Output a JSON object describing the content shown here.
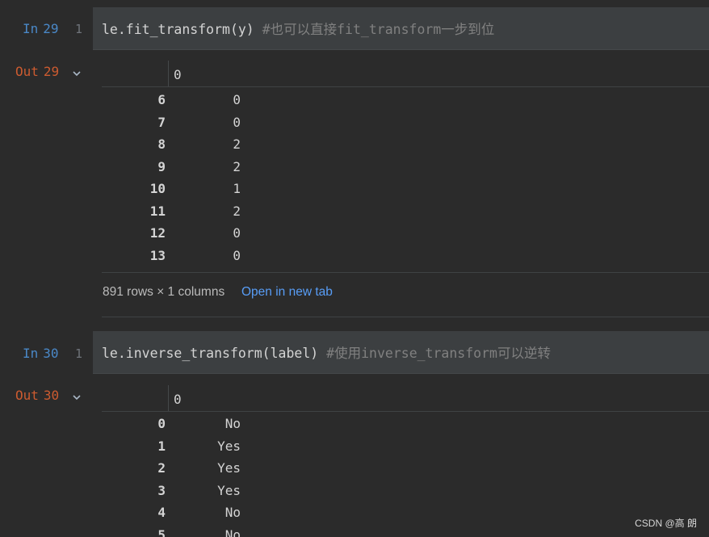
{
  "cells": [
    {
      "in_label": "In",
      "in_number": "29",
      "line_number": "1",
      "code": "le.fit_transform(y) ",
      "comment": "#也可以直接fit_transform一步到位",
      "out_label": "Out",
      "out_number": "29",
      "column_header": "0",
      "rows": [
        {
          "index": "6",
          "value": "0"
        },
        {
          "index": "7",
          "value": "0"
        },
        {
          "index": "8",
          "value": "2"
        },
        {
          "index": "9",
          "value": "2"
        },
        {
          "index": "10",
          "value": "1"
        },
        {
          "index": "11",
          "value": "2"
        },
        {
          "index": "12",
          "value": "0"
        },
        {
          "index": "13",
          "value": "0"
        }
      ],
      "footer_text": "891 rows × 1 columns",
      "footer_link": "Open in new tab"
    },
    {
      "in_label": "In",
      "in_number": "30",
      "line_number": "1",
      "code": "le.inverse_transform(label) ",
      "comment": "#使用inverse_transform可以逆转",
      "out_label": "Out",
      "out_number": "30",
      "column_header": "0",
      "rows": [
        {
          "index": "0",
          "value": "No"
        },
        {
          "index": "1",
          "value": "Yes"
        },
        {
          "index": "2",
          "value": "Yes"
        },
        {
          "index": "3",
          "value": "Yes"
        },
        {
          "index": "4",
          "value": "No"
        },
        {
          "index": "5",
          "value": "No"
        }
      ]
    }
  ],
  "watermark": "CSDN @高 朗",
  "colors": {
    "background": "#2b2b2b",
    "code_cell": "#3c3f41",
    "in_prompt": "#4a88c7",
    "out_prompt": "#cc5b30",
    "link": "#589df6",
    "comment": "#808080"
  },
  "icons": {
    "collapse": "chevron-down-icon"
  }
}
